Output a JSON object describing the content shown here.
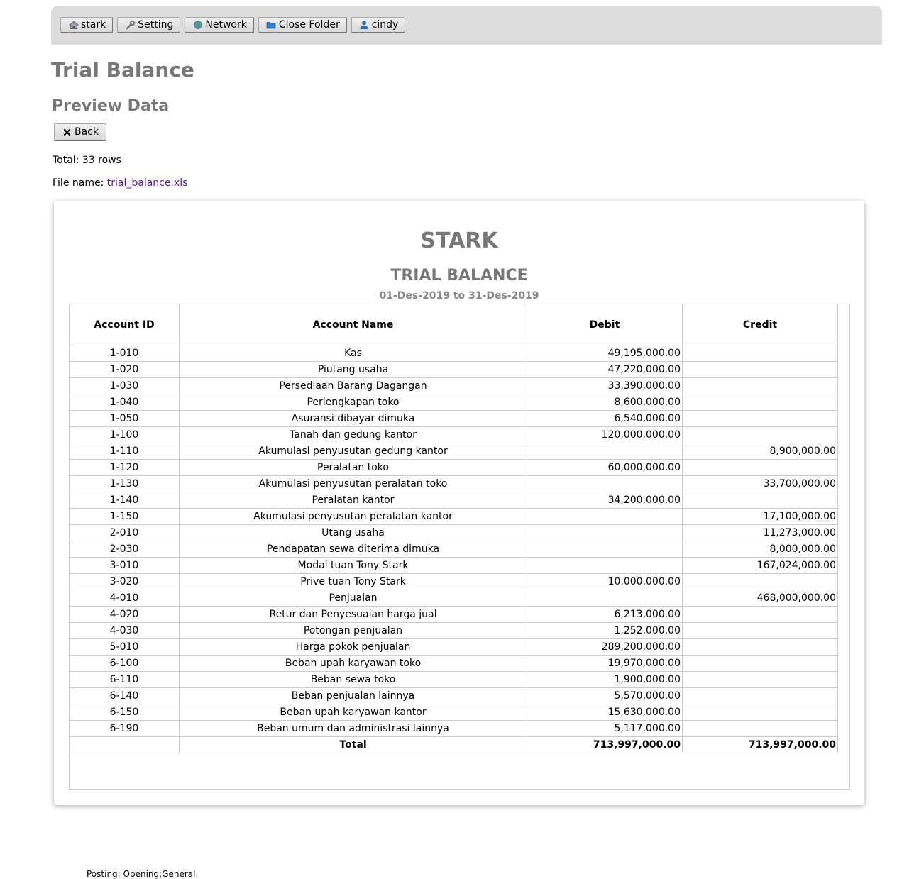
{
  "toolbar": {
    "buttons": [
      {
        "label": "stark",
        "icon": "home-icon"
      },
      {
        "label": "Setting",
        "icon": "wrench-icon"
      },
      {
        "label": "Network",
        "icon": "globe-icon"
      },
      {
        "label": "Close Folder",
        "icon": "folder-icon"
      },
      {
        "label": "cindy",
        "icon": "user-icon"
      }
    ]
  },
  "page": {
    "title": "Trial Balance",
    "subtitle": "Preview Data",
    "back_label": "Back",
    "back_icon": "close-icon"
  },
  "info": {
    "total_text": "Total: 33 rows",
    "file_label": "File name:",
    "file_name": "trial_balance.xls"
  },
  "report": {
    "company": "STARK",
    "title": "TRIAL BALANCE",
    "period": "01-Des-2019 to 31-Des-2019",
    "columns": [
      "Account ID",
      "Account Name",
      "Debit",
      "Credit"
    ],
    "rows": [
      {
        "id": "1-010",
        "name": "Kas",
        "debit": "49,195,000.00",
        "credit": ""
      },
      {
        "id": "1-020",
        "name": "Piutang usaha",
        "debit": "47,220,000.00",
        "credit": ""
      },
      {
        "id": "1-030",
        "name": "Persediaan Barang Dagangan",
        "debit": "33,390,000.00",
        "credit": ""
      },
      {
        "id": "1-040",
        "name": "Perlengkapan toko",
        "debit": "8,600,000.00",
        "credit": ""
      },
      {
        "id": "1-050",
        "name": "Asuransi dibayar dimuka",
        "debit": "6,540,000.00",
        "credit": ""
      },
      {
        "id": "1-100",
        "name": "Tanah dan gedung kantor",
        "debit": "120,000,000.00",
        "credit": ""
      },
      {
        "id": "1-110",
        "name": "Akumulasi penyusutan gedung kantor",
        "debit": "",
        "credit": "8,900,000.00"
      },
      {
        "id": "1-120",
        "name": "Peralatan toko",
        "debit": "60,000,000.00",
        "credit": ""
      },
      {
        "id": "1-130",
        "name": "Akumulasi penyusutan peralatan toko",
        "debit": "",
        "credit": "33,700,000.00"
      },
      {
        "id": "1-140",
        "name": "Peralatan kantor",
        "debit": "34,200,000.00",
        "credit": ""
      },
      {
        "id": "1-150",
        "name": "Akumulasi penyusutan peralatan kantor",
        "debit": "",
        "credit": "17,100,000.00"
      },
      {
        "id": "2-010",
        "name": "Utang usaha",
        "debit": "",
        "credit": "11,273,000.00"
      },
      {
        "id": "2-030",
        "name": "Pendapatan sewa diterima dimuka",
        "debit": "",
        "credit": "8,000,000.00"
      },
      {
        "id": "3-010",
        "name": "Modal tuan Tony Stark",
        "debit": "",
        "credit": "167,024,000.00"
      },
      {
        "id": "3-020",
        "name": "Prive tuan Tony Stark",
        "debit": "10,000,000.00",
        "credit": ""
      },
      {
        "id": "4-010",
        "name": "Penjualan",
        "debit": "",
        "credit": "468,000,000.00"
      },
      {
        "id": "4-020",
        "name": "Retur dan Penyesuaian harga jual",
        "debit": "6,213,000.00",
        "credit": ""
      },
      {
        "id": "4-030",
        "name": "Potongan penjualan",
        "debit": "1,252,000.00",
        "credit": ""
      },
      {
        "id": "5-010",
        "name": "Harga pokok penjualan",
        "debit": "289,200,000.00",
        "credit": ""
      },
      {
        "id": "6-100",
        "name": "Beban upah karyawan toko",
        "debit": "19,970,000.00",
        "credit": ""
      },
      {
        "id": "6-110",
        "name": "Beban sewa toko",
        "debit": "1,900,000.00",
        "credit": ""
      },
      {
        "id": "6-140",
        "name": "Beban penjualan lainnya",
        "debit": "5,570,000.00",
        "credit": ""
      },
      {
        "id": "6-150",
        "name": "Beban upah karyawan kantor",
        "debit": "15,630,000.00",
        "credit": ""
      },
      {
        "id": "6-190",
        "name": "Beban umum dan administrasi lainnya",
        "debit": "5,117,000.00",
        "credit": ""
      }
    ],
    "total": {
      "label": "Total",
      "debit": "713,997,000.00",
      "credit": "713,997,000.00"
    },
    "posting": "Posting: Opening;General."
  }
}
